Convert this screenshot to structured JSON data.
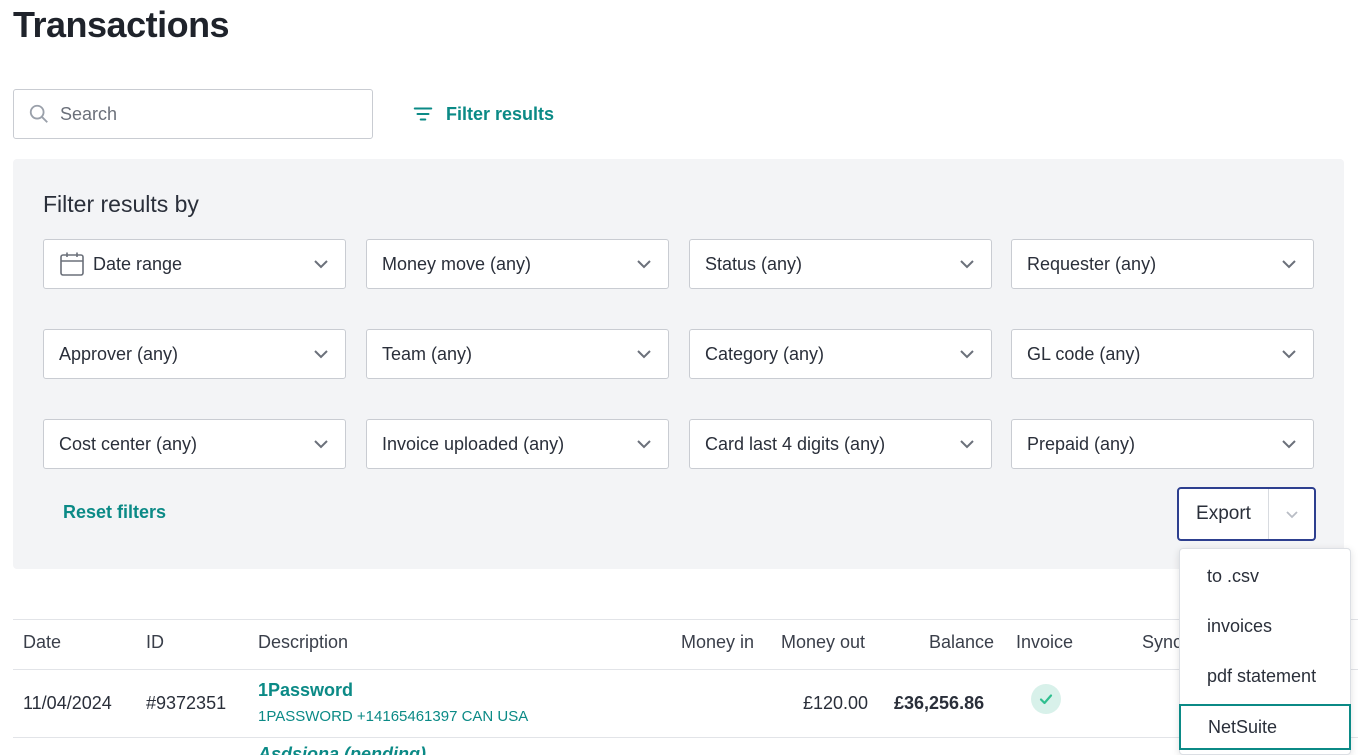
{
  "page": {
    "title": "Transactions"
  },
  "search": {
    "placeholder": "Search",
    "value": ""
  },
  "toolbar": {
    "filter_results_label": "Filter results"
  },
  "filters": {
    "title": "Filter results by",
    "dropdowns": [
      {
        "label": "Date range",
        "icon": "calendar-icon"
      },
      {
        "label": "Money move (any)"
      },
      {
        "label": "Status (any)"
      },
      {
        "label": "Requester (any)"
      },
      {
        "label": "Approver (any)"
      },
      {
        "label": "Team (any)"
      },
      {
        "label": "Category (any)"
      },
      {
        "label": "GL code (any)"
      },
      {
        "label": "Cost center (any)"
      },
      {
        "label": "Invoice uploaded (any)"
      },
      {
        "label": "Card last 4 digits (any)"
      },
      {
        "label": "Prepaid (any)"
      }
    ],
    "reset_label": "Reset filters"
  },
  "export": {
    "label": "Export",
    "menu": [
      "to .csv",
      "invoices",
      "pdf statement",
      "NetSuite"
    ],
    "focused_item": "NetSuite"
  },
  "table": {
    "columns": [
      "Date",
      "ID",
      "Description",
      "Money in",
      "Money out",
      "Balance",
      "Invoice",
      "Sync"
    ],
    "rows": [
      {
        "date": "11/04/2024",
        "id": "#9372351",
        "description": "1Password",
        "merchant": "1PASSWORD +14165461397 CAN USA",
        "money_in": "",
        "money_out": "£120.00",
        "balance": "£36,256.86",
        "invoice_status": "uploaded"
      }
    ],
    "next_row_partial_title": "Asdsiona (pending)"
  },
  "colors": {
    "accent": "#0b8a86",
    "export_border": "#2d3f8f",
    "panel_bg": "#f3f4f6"
  }
}
